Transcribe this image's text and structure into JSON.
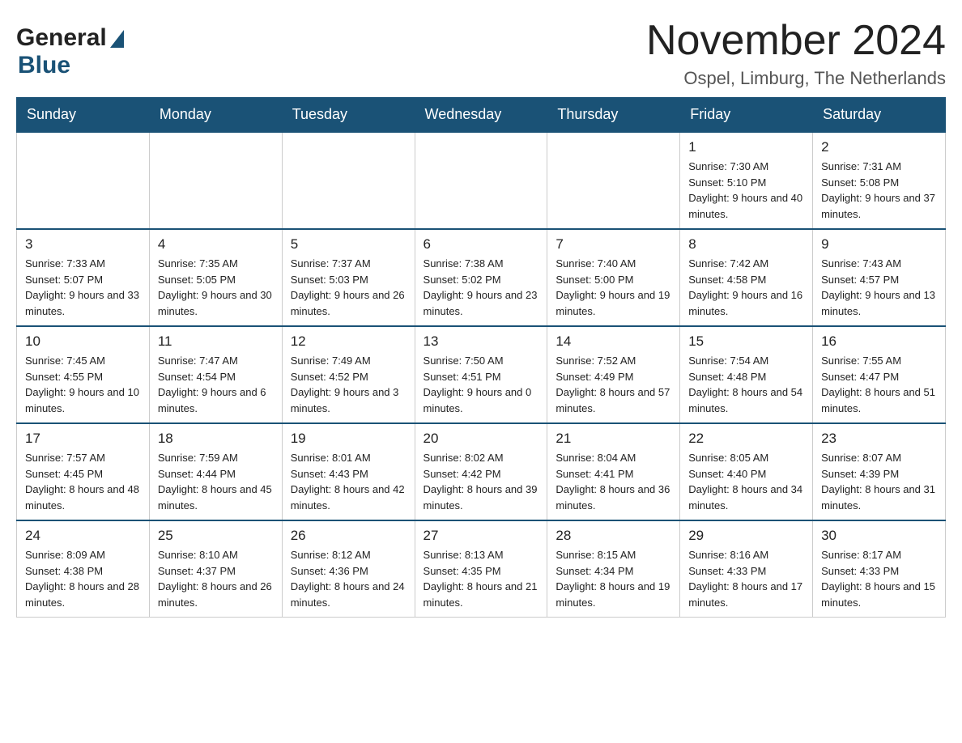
{
  "header": {
    "logo": {
      "general": "General",
      "arrow_char": "▶",
      "blue": "Blue"
    },
    "title": "November 2024",
    "location": "Ospel, Limburg, The Netherlands"
  },
  "calendar": {
    "days_of_week": [
      "Sunday",
      "Monday",
      "Tuesday",
      "Wednesday",
      "Thursday",
      "Friday",
      "Saturday"
    ],
    "weeks": [
      [
        {
          "day": "",
          "info": ""
        },
        {
          "day": "",
          "info": ""
        },
        {
          "day": "",
          "info": ""
        },
        {
          "day": "",
          "info": ""
        },
        {
          "day": "",
          "info": ""
        },
        {
          "day": "1",
          "info": "Sunrise: 7:30 AM\nSunset: 5:10 PM\nDaylight: 9 hours and 40 minutes."
        },
        {
          "day": "2",
          "info": "Sunrise: 7:31 AM\nSunset: 5:08 PM\nDaylight: 9 hours and 37 minutes."
        }
      ],
      [
        {
          "day": "3",
          "info": "Sunrise: 7:33 AM\nSunset: 5:07 PM\nDaylight: 9 hours and 33 minutes."
        },
        {
          "day": "4",
          "info": "Sunrise: 7:35 AM\nSunset: 5:05 PM\nDaylight: 9 hours and 30 minutes."
        },
        {
          "day": "5",
          "info": "Sunrise: 7:37 AM\nSunset: 5:03 PM\nDaylight: 9 hours and 26 minutes."
        },
        {
          "day": "6",
          "info": "Sunrise: 7:38 AM\nSunset: 5:02 PM\nDaylight: 9 hours and 23 minutes."
        },
        {
          "day": "7",
          "info": "Sunrise: 7:40 AM\nSunset: 5:00 PM\nDaylight: 9 hours and 19 minutes."
        },
        {
          "day": "8",
          "info": "Sunrise: 7:42 AM\nSunset: 4:58 PM\nDaylight: 9 hours and 16 minutes."
        },
        {
          "day": "9",
          "info": "Sunrise: 7:43 AM\nSunset: 4:57 PM\nDaylight: 9 hours and 13 minutes."
        }
      ],
      [
        {
          "day": "10",
          "info": "Sunrise: 7:45 AM\nSunset: 4:55 PM\nDaylight: 9 hours and 10 minutes."
        },
        {
          "day": "11",
          "info": "Sunrise: 7:47 AM\nSunset: 4:54 PM\nDaylight: 9 hours and 6 minutes."
        },
        {
          "day": "12",
          "info": "Sunrise: 7:49 AM\nSunset: 4:52 PM\nDaylight: 9 hours and 3 minutes."
        },
        {
          "day": "13",
          "info": "Sunrise: 7:50 AM\nSunset: 4:51 PM\nDaylight: 9 hours and 0 minutes."
        },
        {
          "day": "14",
          "info": "Sunrise: 7:52 AM\nSunset: 4:49 PM\nDaylight: 8 hours and 57 minutes."
        },
        {
          "day": "15",
          "info": "Sunrise: 7:54 AM\nSunset: 4:48 PM\nDaylight: 8 hours and 54 minutes."
        },
        {
          "day": "16",
          "info": "Sunrise: 7:55 AM\nSunset: 4:47 PM\nDaylight: 8 hours and 51 minutes."
        }
      ],
      [
        {
          "day": "17",
          "info": "Sunrise: 7:57 AM\nSunset: 4:45 PM\nDaylight: 8 hours and 48 minutes."
        },
        {
          "day": "18",
          "info": "Sunrise: 7:59 AM\nSunset: 4:44 PM\nDaylight: 8 hours and 45 minutes."
        },
        {
          "day": "19",
          "info": "Sunrise: 8:01 AM\nSunset: 4:43 PM\nDaylight: 8 hours and 42 minutes."
        },
        {
          "day": "20",
          "info": "Sunrise: 8:02 AM\nSunset: 4:42 PM\nDaylight: 8 hours and 39 minutes."
        },
        {
          "day": "21",
          "info": "Sunrise: 8:04 AM\nSunset: 4:41 PM\nDaylight: 8 hours and 36 minutes."
        },
        {
          "day": "22",
          "info": "Sunrise: 8:05 AM\nSunset: 4:40 PM\nDaylight: 8 hours and 34 minutes."
        },
        {
          "day": "23",
          "info": "Sunrise: 8:07 AM\nSunset: 4:39 PM\nDaylight: 8 hours and 31 minutes."
        }
      ],
      [
        {
          "day": "24",
          "info": "Sunrise: 8:09 AM\nSunset: 4:38 PM\nDaylight: 8 hours and 28 minutes."
        },
        {
          "day": "25",
          "info": "Sunrise: 8:10 AM\nSunset: 4:37 PM\nDaylight: 8 hours and 26 minutes."
        },
        {
          "day": "26",
          "info": "Sunrise: 8:12 AM\nSunset: 4:36 PM\nDaylight: 8 hours and 24 minutes."
        },
        {
          "day": "27",
          "info": "Sunrise: 8:13 AM\nSunset: 4:35 PM\nDaylight: 8 hours and 21 minutes."
        },
        {
          "day": "28",
          "info": "Sunrise: 8:15 AM\nSunset: 4:34 PM\nDaylight: 8 hours and 19 minutes."
        },
        {
          "day": "29",
          "info": "Sunrise: 8:16 AM\nSunset: 4:33 PM\nDaylight: 8 hours and 17 minutes."
        },
        {
          "day": "30",
          "info": "Sunrise: 8:17 AM\nSunset: 4:33 PM\nDaylight: 8 hours and 15 minutes."
        }
      ]
    ]
  }
}
